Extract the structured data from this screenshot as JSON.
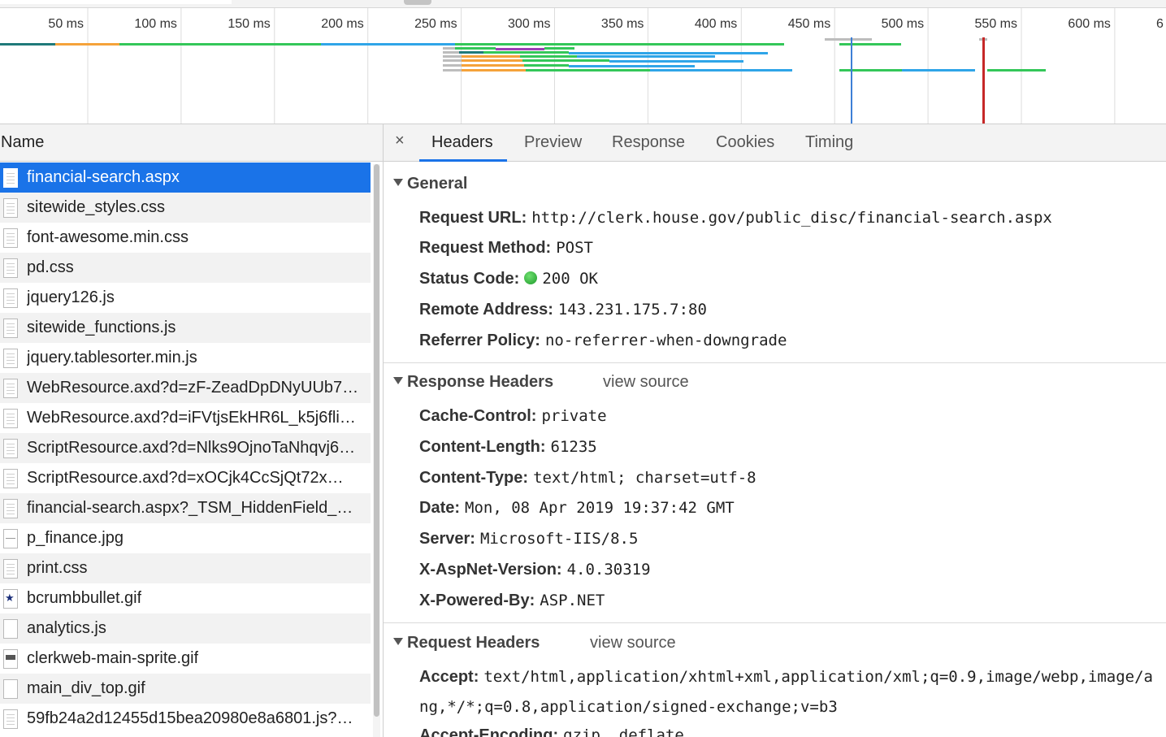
{
  "timeline": {
    "ticks": [
      "50 ms",
      "100 ms",
      "150 ms",
      "200 ms",
      "250 ms",
      "300 ms",
      "350 ms",
      "400 ms",
      "450 ms",
      "500 ms",
      "550 ms",
      "600 ms",
      "6"
    ],
    "colors": {
      "waiting": "#34c759",
      "download": "#2fa5e8",
      "connect": "#f5a23a",
      "ssl": "#9b3fb5",
      "queue": "#bdbdbd",
      "stalled": "#1f7a7a",
      "dom_content_loaded": "#3d7fd6",
      "load": "#c62828"
    }
  },
  "name_panel": {
    "header": "Name",
    "rows": [
      {
        "name": "financial-search.aspx",
        "icon": "doc",
        "selected": true
      },
      {
        "name": "sitewide_styles.css",
        "icon": "doc"
      },
      {
        "name": "font-awesome.min.css",
        "icon": "doc"
      },
      {
        "name": "pd.css",
        "icon": "doc"
      },
      {
        "name": "jquery126.js",
        "icon": "doc"
      },
      {
        "name": "sitewide_functions.js",
        "icon": "doc"
      },
      {
        "name": "jquery.tablesorter.min.js",
        "icon": "doc"
      },
      {
        "name": "WebResource.axd?d=zF-ZeadDpDNyUUb7…",
        "icon": "doc"
      },
      {
        "name": "WebResource.axd?d=iFVtjsEkHR6L_k5j6fli…",
        "icon": "doc"
      },
      {
        "name": "ScriptResource.axd?d=Nlks9OjnoTaNhqvj6…",
        "icon": "doc"
      },
      {
        "name": "ScriptResource.axd?d=xOCjk4CcSjQt72x…",
        "icon": "doc"
      },
      {
        "name": "financial-search.aspx?_TSM_HiddenField_…",
        "icon": "doc"
      },
      {
        "name": "p_finance.jpg",
        "icon": "img"
      },
      {
        "name": "print.css",
        "icon": "doc"
      },
      {
        "name": "bcrumbbullet.gif",
        "icon": "star"
      },
      {
        "name": "analytics.js",
        "icon": "blank"
      },
      {
        "name": "clerkweb-main-sprite.gif",
        "icon": "sprite"
      },
      {
        "name": "main_div_top.gif",
        "icon": "blank"
      },
      {
        "name": "59fb24a2d12455d15bea20980e8a6801.js?…",
        "icon": "doc"
      }
    ]
  },
  "detail": {
    "close_label": "×",
    "tabs": [
      "Headers",
      "Preview",
      "Response",
      "Cookies",
      "Timing"
    ],
    "active_tab": "Headers",
    "general": {
      "title": "General",
      "request_url_label": "Request URL:",
      "request_url": "http://clerk.house.gov/public_disc/financial-search.aspx",
      "request_method_label": "Request Method:",
      "request_method": "POST",
      "status_code_label": "Status Code:",
      "status_code": "200 OK",
      "remote_address_label": "Remote Address:",
      "remote_address": "143.231.175.7:80",
      "referrer_policy_label": "Referrer Policy:",
      "referrer_policy": "no-referrer-when-downgrade"
    },
    "response_headers": {
      "title": "Response Headers",
      "view_source": "view source",
      "items": [
        {
          "k": "Cache-Control:",
          "v": "private"
        },
        {
          "k": "Content-Length:",
          "v": "61235"
        },
        {
          "k": "Content-Type:",
          "v": "text/html; charset=utf-8"
        },
        {
          "k": "Date:",
          "v": "Mon, 08 Apr 2019 19:37:42 GMT"
        },
        {
          "k": "Server:",
          "v": "Microsoft-IIS/8.5"
        },
        {
          "k": "X-AspNet-Version:",
          "v": "4.0.30319"
        },
        {
          "k": "X-Powered-By:",
          "v": "ASP.NET"
        }
      ]
    },
    "request_headers": {
      "title": "Request Headers",
      "view_source": "view source",
      "accept_label": "Accept:",
      "accept_value": "text/html,application/xhtml+xml,application/xml;q=0.9,image/webp,image/a",
      "accept_cont": "ng,*/*;q=0.8,application/signed-exchange;v=b3",
      "accept_encoding_label": "Accept-Encoding:",
      "accept_encoding_value": "gzip, deflate"
    }
  }
}
